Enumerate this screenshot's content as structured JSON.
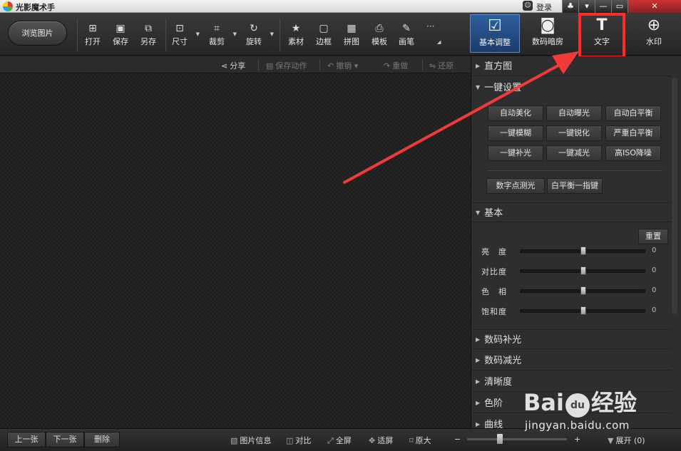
{
  "titlebar": {
    "app_title": "光影魔术手",
    "login": "登录",
    "buttons": [
      "♣",
      "▾",
      "—",
      "▭",
      "✕"
    ]
  },
  "toolbar": {
    "browse": "浏览图片",
    "tools": [
      {
        "label": "打开",
        "icon": "open-image-icon",
        "glyph": "⊞"
      },
      {
        "label": "保存",
        "icon": "save-icon",
        "glyph": "▣"
      },
      {
        "label": "另存",
        "icon": "save-as-icon",
        "glyph": "⧉"
      },
      {
        "label": "尺寸",
        "icon": "resize-icon",
        "glyph": "⊡"
      },
      {
        "label": "裁剪",
        "icon": "crop-icon",
        "glyph": "⌗"
      },
      {
        "label": "旋转",
        "icon": "rotate-icon",
        "glyph": "↻"
      },
      {
        "label": "素材",
        "icon": "material-icon",
        "glyph": "★"
      },
      {
        "label": "边框",
        "icon": "border-icon",
        "glyph": "▢"
      },
      {
        "label": "拼图",
        "icon": "collage-icon",
        "glyph": "▦"
      },
      {
        "label": "模板",
        "icon": "template-icon",
        "glyph": "⎙"
      },
      {
        "label": "画笔",
        "icon": "brush-icon",
        "glyph": "✎"
      }
    ],
    "more": "···"
  },
  "panel_tabs": [
    {
      "label": "基本调整",
      "icon": "basic-adjust-icon",
      "glyph": "☑"
    },
    {
      "label": "数码暗房",
      "icon": "camera-icon",
      "glyph": "◙"
    },
    {
      "label": "文字",
      "icon": "text-icon",
      "glyph": "T"
    },
    {
      "label": "水印",
      "icon": "watermark-icon",
      "glyph": "⊕"
    }
  ],
  "actionbar": {
    "share": "分享",
    "save_action": "保存动作",
    "undo": "撤销",
    "redo": "重做",
    "restore": "还原"
  },
  "panel": {
    "histogram": "直方图",
    "one_click": "一键设置",
    "one_click_buttons": [
      [
        "自动美化",
        "自动曝光",
        "自动白平衡"
      ],
      [
        "一键模糊",
        "一键锐化",
        "严重白平衡"
      ],
      [
        "一键补光",
        "一键减光",
        "高ISO降噪"
      ]
    ],
    "extra_buttons": [
      "数字点测光",
      "白平衡一指键"
    ],
    "basic": "基本",
    "reset": "重置",
    "sliders": [
      {
        "label": "亮　度",
        "value": 0
      },
      {
        "label": "对比度",
        "value": 0
      },
      {
        "label": "色　相",
        "value": 0
      },
      {
        "label": "饱和度",
        "value": 0
      }
    ],
    "collapsed_sections": [
      "数码补光",
      "数码减光",
      "清晰度",
      "色阶",
      "曲线"
    ]
  },
  "bottombar": {
    "prev": "上一张",
    "next": "下一张",
    "delete": "删除",
    "info": "图片信息",
    "compare": "对比",
    "fullscreen": "全屏",
    "fit": "适屏",
    "original": "原大",
    "zoom_minus": "−",
    "zoom_plus": "+",
    "expand": "展开",
    "expand_count": "(0)"
  },
  "watermark": {
    "brand_left": "Bai",
    "brand_paw": "du",
    "brand_right": "经验",
    "site": "jingyan.baidu.com"
  },
  "colors": {
    "highlight": "#ff2a2a",
    "active_tab": "#2f5f9e"
  }
}
